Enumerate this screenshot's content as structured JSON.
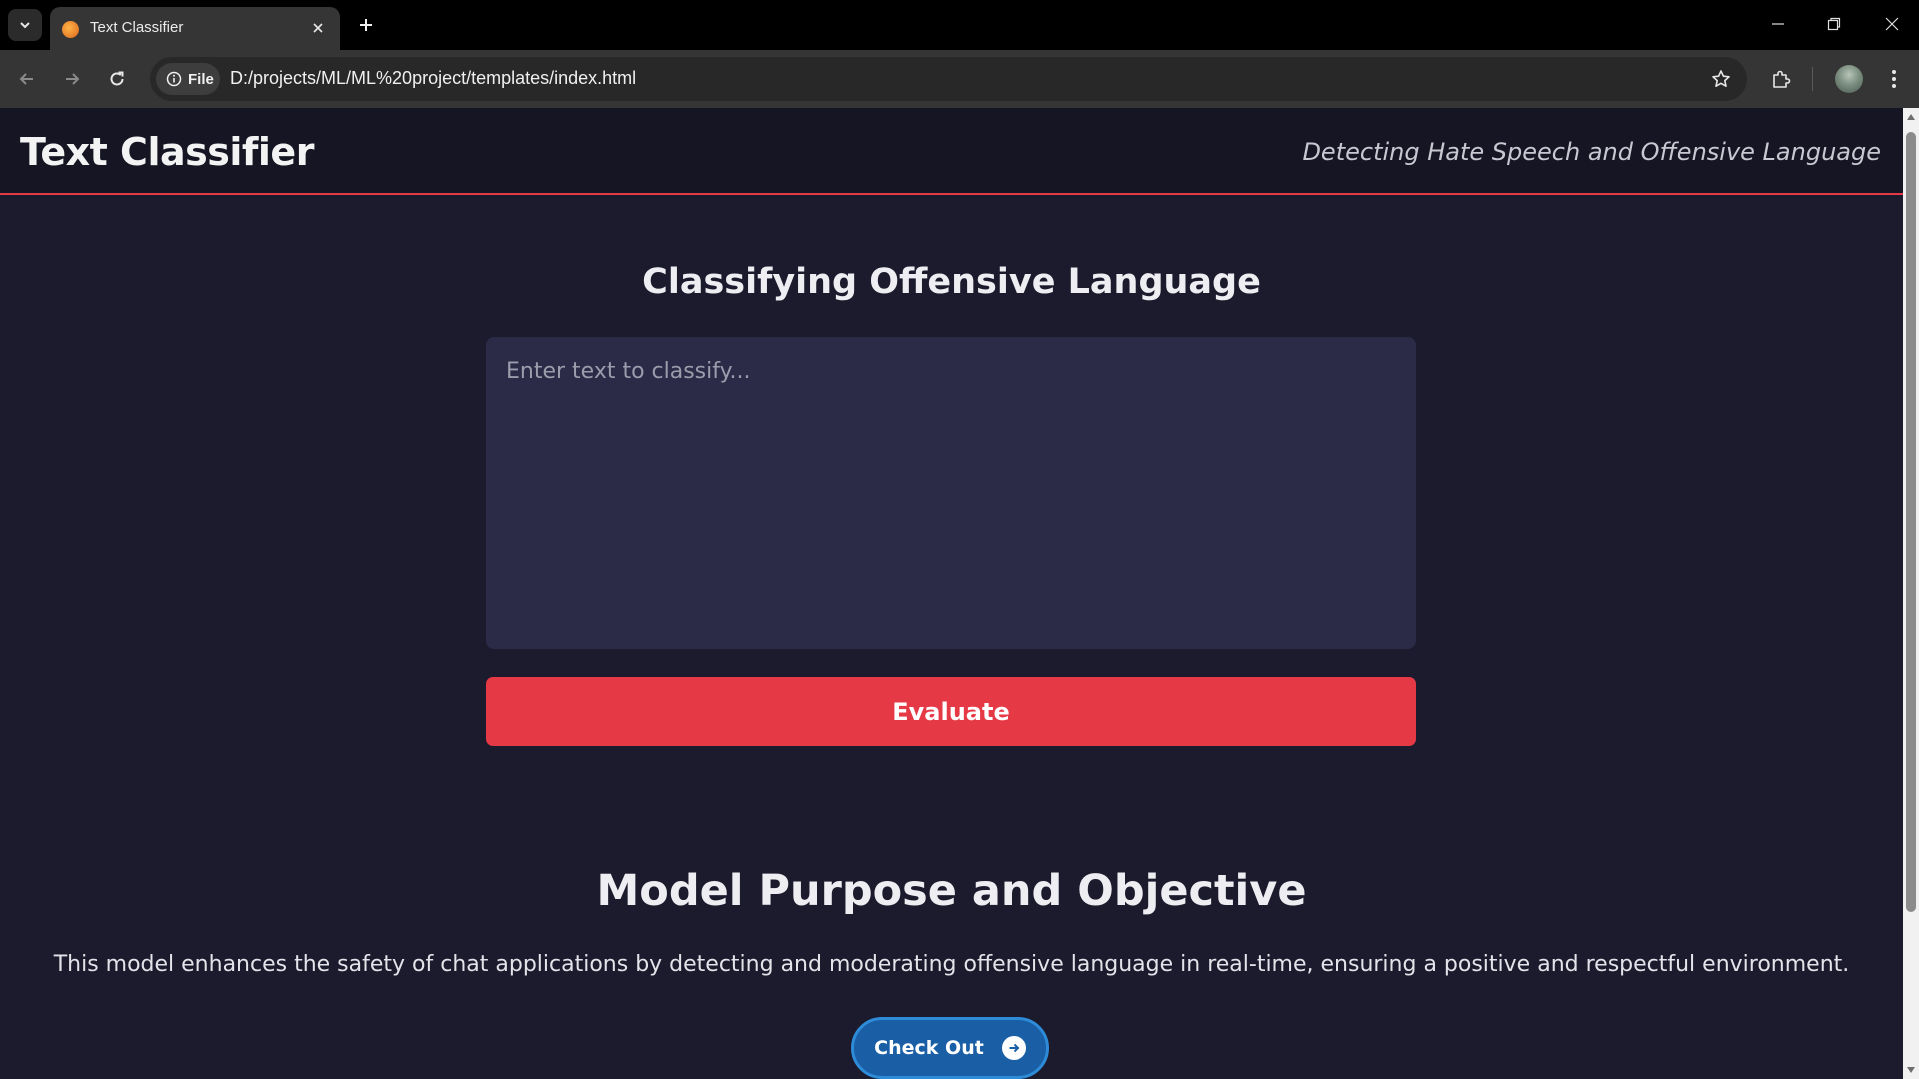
{
  "browser": {
    "tab_title": "Text Classifier",
    "site_chip_label": "File",
    "url": "D:/projects/ML/ML%20project/templates/index.html"
  },
  "header": {
    "title": "Text Classifier",
    "tagline": "Detecting Hate Speech and Offensive Language"
  },
  "classifier": {
    "heading": "Classifying Offensive Language",
    "input_placeholder": "Enter text to classify...",
    "input_value": "",
    "evaluate_label": "Evaluate"
  },
  "purpose": {
    "heading": "Model Purpose and Objective",
    "description": "This model enhances the safety of chat applications by detecting and moderating offensive language in real-time, ensuring a positive and respectful environment.",
    "checkout_label": "Check Out"
  },
  "icons": {
    "tab_menu": "chevron-down-icon",
    "favicon": "favicon-icon",
    "tab_close": "close-icon",
    "new_tab": "plus-icon",
    "back": "back-arrow-icon",
    "forward": "forward-arrow-icon",
    "reload": "reload-icon",
    "info": "info-icon",
    "bookmark": "star-icon",
    "extensions": "puzzle-icon",
    "menu": "kebab-menu-icon",
    "checkout": "arrow-right-circle-icon"
  },
  "colors": {
    "page_bg": "#1b1b2d",
    "header_bg": "#151523",
    "accent": "#e63946",
    "textarea_bg": "#2b2a47",
    "checkout_bg": "#1a5fa6"
  }
}
